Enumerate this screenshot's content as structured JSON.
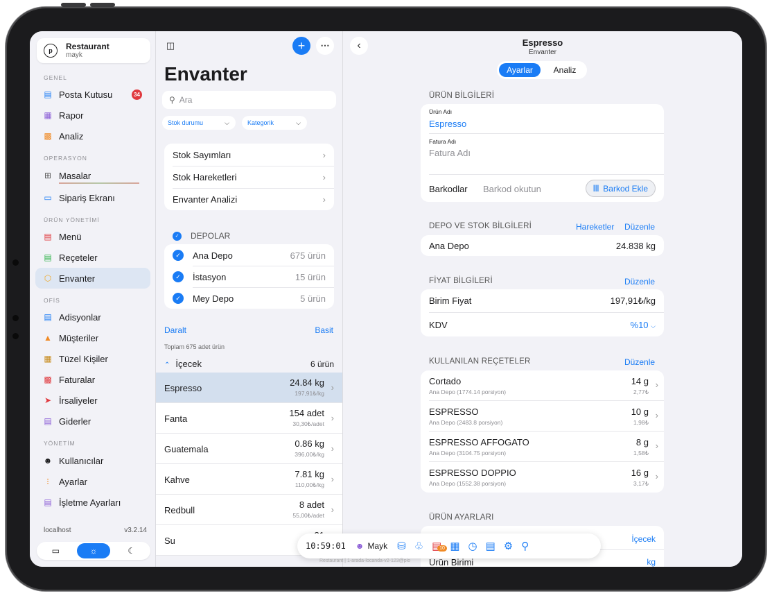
{
  "sidebar": {
    "profile": {
      "name": "Restaurant",
      "user": "mayk",
      "logo_text": "p"
    },
    "sections": {
      "genel": "GENEL",
      "operasyon": "OPERASYON",
      "urun": "ÜRÜN YÖNETİMİ",
      "ofis": "OFİS",
      "yonetim": "YÖNETİM"
    },
    "items": [
      {
        "label": "Posta Kutusu",
        "icon": "inbox-icon",
        "badge": "34"
      },
      {
        "label": "Rapor",
        "icon": "printer-icon"
      },
      {
        "label": "Analiz",
        "icon": "chart-icon"
      },
      {
        "label": "Masalar",
        "icon": "grid-icon"
      },
      {
        "label": "Sipariş Ekranı",
        "icon": "monitor-icon"
      },
      {
        "label": "Menü",
        "icon": "menu-book-icon"
      },
      {
        "label": "Reçeteler",
        "icon": "recipe-icon"
      },
      {
        "label": "Envanter",
        "icon": "box-icon"
      },
      {
        "label": "Adisyonlar",
        "icon": "receipt-icon"
      },
      {
        "label": "Müşteriler",
        "icon": "people-icon"
      },
      {
        "label": "Tüzel Kişiler",
        "icon": "building-icon"
      },
      {
        "label": "Faturalar",
        "icon": "invoice-icon"
      },
      {
        "label": "İrsaliyeler",
        "icon": "send-icon"
      },
      {
        "label": "Giderler",
        "icon": "expense-icon"
      },
      {
        "label": "Kullanıcılar",
        "icon": "users-icon"
      },
      {
        "label": "Ayarlar",
        "icon": "sliders-icon"
      },
      {
        "label": "İşletme Ayarları",
        "icon": "business-icon"
      }
    ],
    "host": "localhost",
    "version": "v3.2.14"
  },
  "inventory": {
    "title": "Envanter",
    "search_placeholder": "Ara",
    "filter_stock": "Stok durumu",
    "filter_category": "Kategorik",
    "links": [
      "Stok Sayımları",
      "Stok Hareketleri",
      "Envanter Analizi"
    ],
    "depots_header": "DEPOLAR",
    "depots": [
      {
        "name": "Ana Depo",
        "count": "675 ürün"
      },
      {
        "name": "İstasyon",
        "count": "15 ürün"
      },
      {
        "name": "Mey Depo",
        "count": "5 ürün"
      }
    ],
    "collapse": "Daralt",
    "simple": "Basit",
    "total": "Toplam 675 adet ürün",
    "group": {
      "name": "İçecek",
      "count": "6 ürün"
    },
    "products": [
      {
        "name": "Espresso",
        "qty": "24.84 kg",
        "price": "197,91₺/kg"
      },
      {
        "name": "Fanta",
        "qty": "154 adet",
        "price": "30,30₺/adet"
      },
      {
        "name": "Guatemala",
        "qty": "0.86 kg",
        "price": "396,00₺/kg"
      },
      {
        "name": "Kahve",
        "qty": "7.81 kg",
        "price": "110,00₺/kg"
      },
      {
        "name": "Redbull",
        "qty": "8 adet",
        "price": "55,00₺/adet"
      },
      {
        "name": "Su",
        "qty": "31",
        "price": "9,"
      }
    ]
  },
  "detail": {
    "title": "Espresso",
    "subtitle": "Envanter",
    "tabs": [
      "Ayarlar",
      "Analiz"
    ],
    "product_info": {
      "header": "ÜRÜN BİLGİLERİ",
      "name_label": "Ürün Adı",
      "name_value": "Espresso",
      "invoice_label": "Fatura Adı",
      "invoice_placeholder": "Fatura Adı",
      "barcode_label": "Barkodlar",
      "barcode_placeholder": "Barkod okutun",
      "barcode_button": "Barkod Ekle"
    },
    "stock": {
      "header": "DEPO VE STOK BİLGİLERİ",
      "action1": "Hareketler",
      "action2": "Düzenle",
      "depot": "Ana Depo",
      "amount": "24.838 kg"
    },
    "price": {
      "header": "FİYAT BİLGİLERİ",
      "action": "Düzenle",
      "unit_label": "Birim Fiyat",
      "unit_value": "197,91₺/kg",
      "vat_label": "KDV",
      "vat_value": "%10"
    },
    "recipes": {
      "header": "KULLANILAN REÇETELER",
      "action": "Düzenle",
      "items": [
        {
          "name": "Cortado",
          "desc": "Ana Depo (1774.14 porsiyon)",
          "qty": "14 g",
          "cost": "2,77₺"
        },
        {
          "name": "ESPRESSO",
          "desc": "Ana Depo (2483.8 porsiyon)",
          "qty": "10 g",
          "cost": "1,98₺"
        },
        {
          "name": "ESPRESSO AFFOGATO",
          "desc": "Ana Depo (3104.75 porsiyon)",
          "qty": "8 g",
          "cost": "1,58₺"
        },
        {
          "name": "ESPRESSO DOPPIO",
          "desc": "Ana Depo (1552.38 porsiyon)",
          "qty": "16 g",
          "cost": "3,17₺"
        }
      ]
    },
    "settings": {
      "header": "ÜRÜN AYARLARI",
      "category": "İçecek",
      "unit_label": "Ürün Birimi",
      "unit_value": "kg"
    }
  },
  "dock": {
    "time": "10:59:01",
    "user": "Mayk",
    "printer_badge": "10",
    "watermark": "Restaurant | 1-arada-locanda-v2-123@pio"
  },
  "colors": {
    "accent": "#1a7cf5",
    "badge": "#e0393e",
    "selected_row": "#d3dfee"
  }
}
